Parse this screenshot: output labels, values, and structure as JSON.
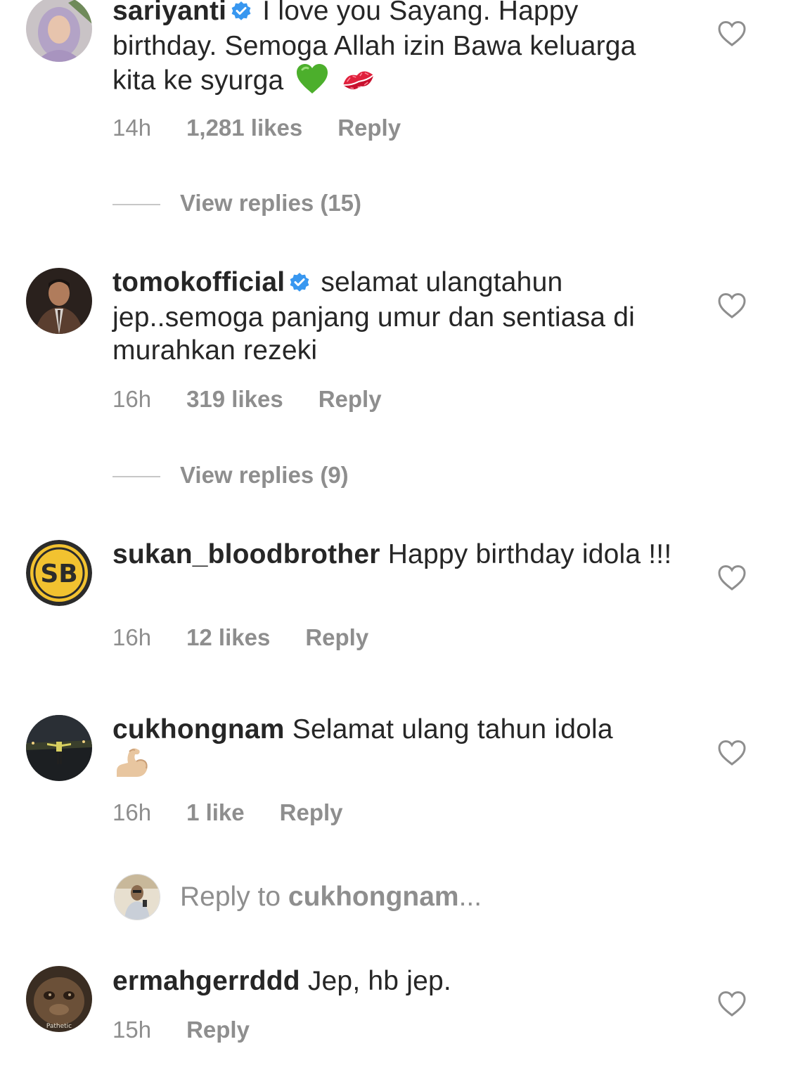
{
  "comments": [
    {
      "username": "sariyanti",
      "verified": true,
      "text": "I love you Sayang. Happy birthday. Semoga Allah izin Bawa keluarga kita ke syurga",
      "emojis": [
        "green-heart",
        "kiss-mark"
      ],
      "time": "14h",
      "likes": "1,281 likes",
      "reply_label": "Reply",
      "view_replies": "View replies (15)"
    },
    {
      "username": "tomokofficial",
      "verified": true,
      "text": "selamat ulangtahun jep..semoga panjang umur dan sentiasa di murahkan rezeki",
      "time": "16h",
      "likes": "319 likes",
      "reply_label": "Reply",
      "view_replies": "View replies (9)"
    },
    {
      "username": "sukan_bloodbrother",
      "verified": false,
      "text": "Happy birthday idola !!!",
      "time": "16h",
      "likes": "12 likes",
      "reply_label": "Reply"
    },
    {
      "username": "cukhongnam",
      "verified": false,
      "text": "Selamat ulang tahun idola",
      "emojis": [
        "flexed-biceps"
      ],
      "time": "16h",
      "likes": "1 like",
      "reply_label": "Reply"
    },
    {
      "username": "ermahgerrddd",
      "verified": false,
      "text": "Jep, hb jep.",
      "time": "15h",
      "reply_label": "Reply",
      "avatar_caption": "Pathetic"
    }
  ],
  "reply_composer": {
    "prefix": "Reply to ",
    "target": "cukhongnam",
    "suffix": "..."
  },
  "avatar_monogram": "SB",
  "colors": {
    "text": "#262626",
    "secondary": "#8e8e8e",
    "verified": "#3897f0",
    "divider": "#c7c7c7"
  },
  "icons": {
    "like": "heart-outline-icon",
    "verified": "verified-badge-icon"
  }
}
